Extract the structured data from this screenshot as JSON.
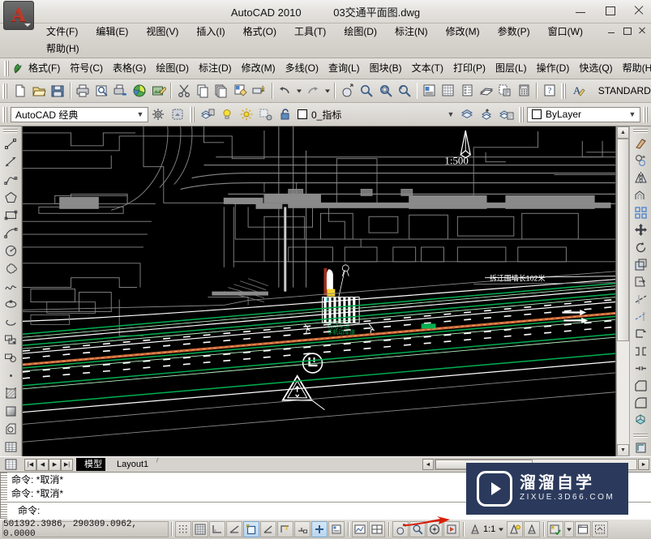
{
  "title_bar": {
    "app_title": "AutoCAD 2010",
    "file_name": "03交通平面图.dwg",
    "minimize": "minimize-window",
    "maximize": "maximize-window",
    "close": "close-window"
  },
  "menu_bar": {
    "items": [
      {
        "label": "文件(F)",
        "name": "menu-file"
      },
      {
        "label": "编辑(E)",
        "name": "menu-edit"
      },
      {
        "label": "视图(V)",
        "name": "menu-view"
      },
      {
        "label": "插入(I)",
        "name": "menu-insert"
      },
      {
        "label": "格式(O)",
        "name": "menu-format"
      },
      {
        "label": "工具(T)",
        "name": "menu-tools"
      },
      {
        "label": "绘图(D)",
        "name": "menu-draw"
      },
      {
        "label": "标注(N)",
        "name": "menu-dimension"
      },
      {
        "label": "修改(M)",
        "name": "menu-modify"
      },
      {
        "label": "参数(P)",
        "name": "menu-parametric"
      },
      {
        "label": "窗口(W)",
        "name": "menu-window"
      }
    ],
    "second_row": [
      {
        "label": "帮助(H)",
        "name": "menu-help"
      }
    ]
  },
  "express_menu": {
    "items": [
      {
        "label": "格式(F)",
        "name": "express-format"
      },
      {
        "label": "符号(C)",
        "name": "express-symbol"
      },
      {
        "label": "表格(G)",
        "name": "express-table"
      },
      {
        "label": "绘图(D)",
        "name": "express-draw"
      },
      {
        "label": "标注(D)",
        "name": "express-dimension"
      },
      {
        "label": "修改(M)",
        "name": "express-modify"
      },
      {
        "label": "多线(O)",
        "name": "express-multiline"
      },
      {
        "label": "查询(L)",
        "name": "express-inquiry"
      },
      {
        "label": "图块(B)",
        "name": "express-block"
      },
      {
        "label": "文本(T)",
        "name": "express-text"
      },
      {
        "label": "打印(P)",
        "name": "express-plot"
      },
      {
        "label": "图层(L)",
        "name": "express-layer"
      },
      {
        "label": "操作(D)",
        "name": "express-operation"
      },
      {
        "label": "快选(Q)",
        "name": "express-quickselect"
      },
      {
        "label": "帮助(H)",
        "name": "express-help"
      }
    ]
  },
  "standard_toolbar": {
    "icons": [
      "new-file-icon",
      "open-file-icon",
      "save-file-icon",
      "plot-icon",
      "plot-preview-icon",
      "publish-icon",
      "3dprint-icon",
      "markup-icon",
      "cut-icon",
      "copy-icon",
      "paste-icon",
      "matchprop-icon",
      "blockeditor-icon",
      "undo-icon",
      "undo-dropdown-icon",
      "redo-icon",
      "redo-dropdown-icon",
      "pan-icon",
      "zoom-realtime-icon",
      "zoom-window-icon",
      "zoom-previous-icon",
      "properties-icon",
      "designcenter-icon",
      "toolpalettes-icon",
      "sheetset-icon",
      "markupset-icon",
      "calculator-icon",
      "help-icon"
    ],
    "style_label": "STANDARD",
    "style_icon": "text-style-icon"
  },
  "workspace_bar": {
    "workspace_value": "AutoCAD 经典",
    "workspace_settings_icon": "workspace-settings-icon",
    "workspace_display_icon": "workspace-display-icon",
    "layer_props_icon": "layer-properties-icon",
    "layer_on_icon": "layer-on-bulb-icon",
    "layer_freeze_icon": "layer-freeze-sun-icon",
    "layer_plot_icon": "layer-plot-icon",
    "layer_lock_icon": "layer-unlock-icon",
    "layer_name": "0_指标",
    "layer_color_swatch": "#ffffff",
    "layer_prev_icon": "layer-previous-icon",
    "layer_make_current_icon": "layer-make-current-icon",
    "layer_state_icon": "layer-state-icon",
    "color_value": "ByLayer",
    "color_swatch": "#ffffff"
  },
  "draw_toolbar": {
    "icons": [
      "line-icon",
      "construction-line-icon",
      "polyline-icon",
      "polygon-icon",
      "rectangle-icon",
      "arc-icon",
      "circle-icon",
      "revision-cloud-icon",
      "spline-icon",
      "ellipse-icon",
      "ellipse-arc-icon",
      "insert-block-icon",
      "make-block-icon",
      "point-icon",
      "hatch-icon",
      "gradient-icon",
      "region-icon",
      "table-icon"
    ]
  },
  "modify_toolbar": {
    "icons": [
      "erase-icon",
      "copy-object-icon",
      "mirror-icon",
      "offset-icon",
      "array-icon",
      "move-icon",
      "rotate-icon",
      "scale-icon",
      "stretch-icon",
      "trim-icon",
      "extend-icon",
      "break-at-point-icon",
      "break-icon",
      "join-icon",
      "chamfer-icon",
      "fillet-icon",
      "explode-icon"
    ]
  },
  "canvas": {
    "background_color": "#000000",
    "scale_label": "1:500",
    "north_arrow": "north-arrow-symbol",
    "annotation_right": "拆迁围墙长102米",
    "layer_colors": {
      "buildings": "#8a8a8a",
      "roads_white": "#ffffff",
      "lane_green": "#00b050",
      "center_orange": "#c86432",
      "sign_yellow": "#ffff00",
      "sign_cyan": "#00ffff"
    },
    "symbols": [
      {
        "name": "traffic-signal-symbol"
      },
      {
        "name": "warning-triangle-sign"
      },
      {
        "name": "pedestrian-crossing"
      },
      {
        "name": "direction-arrow-marking"
      }
    ]
  },
  "scrollbars": {
    "up_arrow": "▲",
    "down_arrow": "▼",
    "left_arrow": "◄",
    "right_arrow": "►"
  },
  "layout_tabs": {
    "nav": [
      "first-tab-icon",
      "prev-tab-icon",
      "next-tab-icon",
      "last-tab-icon"
    ],
    "tabs": [
      {
        "label": "模型",
        "active": true,
        "name": "tab-model"
      },
      {
        "label": "Layout1",
        "active": false,
        "name": "tab-layout1"
      }
    ]
  },
  "command_line": {
    "history": [
      "命令: *取消*",
      "命令: *取消*"
    ],
    "prompt": "命令:"
  },
  "status_bar": {
    "coordinates": "501392.3986,  290309.0962,  0.0000",
    "toggles": [
      {
        "name": "status-snap",
        "icon": "snap-grid-icon",
        "on": false
      },
      {
        "name": "status-grid",
        "icon": "grid-display-icon",
        "on": false
      },
      {
        "name": "status-ortho",
        "icon": "ortho-mode-icon",
        "on": false
      },
      {
        "name": "status-polar",
        "icon": "polar-tracking-icon",
        "on": false
      },
      {
        "name": "status-osnap",
        "icon": "object-snap-icon",
        "on": true
      },
      {
        "name": "status-otrack",
        "icon": "object-snap-tracking-icon",
        "on": false
      },
      {
        "name": "status-ducs",
        "icon": "dynamic-ucs-icon",
        "on": false
      },
      {
        "name": "status-dyn",
        "icon": "dynamic-input-icon",
        "on": false
      },
      {
        "name": "status-lineweight",
        "icon": "lineweight-icon",
        "on": true
      },
      {
        "name": "status-qp",
        "icon": "quick-properties-icon",
        "on": false
      }
    ],
    "right_tools": [
      {
        "name": "status-model-space",
        "icon": "model-space-icon"
      },
      {
        "name": "status-viewport",
        "icon": "quick-view-layouts-icon"
      },
      {
        "name": "status-pan",
        "icon": "pan-icon"
      },
      {
        "name": "status-zoom",
        "icon": "zoom-icon"
      },
      {
        "name": "status-steering",
        "icon": "steering-wheel-icon"
      },
      {
        "name": "status-showmotion",
        "icon": "showmotion-icon"
      }
    ],
    "annotation_scale": "1:1",
    "annotation_scale_icon": "annotation-scale-icon",
    "annotation_visibility_icon": "annotation-visibility-icon",
    "annotation_autoscale_icon": "annotation-autoscale-icon",
    "workspace_switch_icon": "workspace-switching-icon",
    "toolbar_lock_icon": "toolbar-lock-icon",
    "clean_screen_icon": "clean-screen-icon"
  },
  "watermark": {
    "cn_text": "溜溜自学",
    "en_text": "ZIXUE.3D66.COM",
    "logo": "play-button-logo",
    "background": "#2b3a5c"
  }
}
